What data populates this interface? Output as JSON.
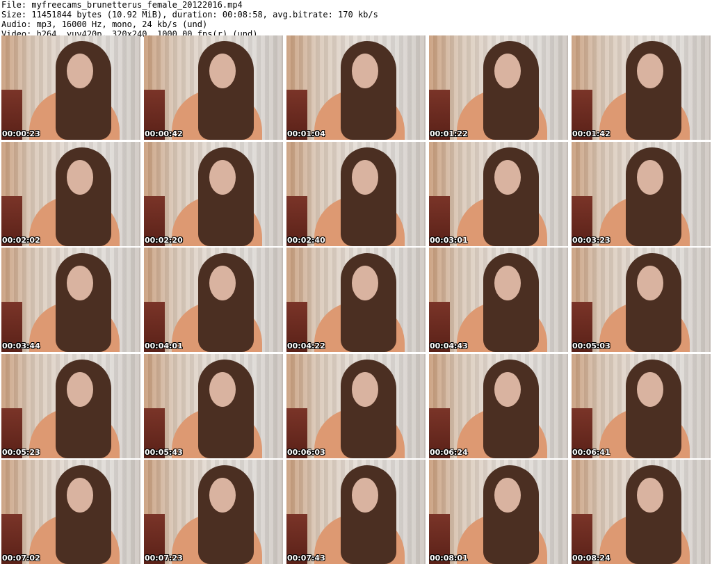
{
  "header": {
    "file_line": "File: myfreecams_brunetterus_female_20122016.mp4",
    "size_line": "Size: 11451844 bytes (10.92 MiB), duration: 00:08:58, avg.bitrate: 170 kb/s",
    "audio_line": "Audio: mp3, 16000 Hz, mono, 24 kb/s (und)",
    "video_line": "Video: h264, yuv420p, 320x240, 1000.00 fps(r) (und)"
  },
  "thumbnails": [
    {
      "timestamp": "00:00:23"
    },
    {
      "timestamp": "00:00:42"
    },
    {
      "timestamp": "00:01:04"
    },
    {
      "timestamp": "00:01:22"
    },
    {
      "timestamp": "00:01:42"
    },
    {
      "timestamp": "00:02:02"
    },
    {
      "timestamp": "00:02:20"
    },
    {
      "timestamp": "00:02:40"
    },
    {
      "timestamp": "00:03:01"
    },
    {
      "timestamp": "00:03:23"
    },
    {
      "timestamp": "00:03:44"
    },
    {
      "timestamp": "00:04:01"
    },
    {
      "timestamp": "00:04:22"
    },
    {
      "timestamp": "00:04:43"
    },
    {
      "timestamp": "00:05:03"
    },
    {
      "timestamp": "00:05:23"
    },
    {
      "timestamp": "00:05:43"
    },
    {
      "timestamp": "00:06:03"
    },
    {
      "timestamp": "00:06:24"
    },
    {
      "timestamp": "00:06:41"
    },
    {
      "timestamp": "00:07:02"
    },
    {
      "timestamp": "00:07:23"
    },
    {
      "timestamp": "00:07:43"
    },
    {
      "timestamp": "00:08:01"
    },
    {
      "timestamp": "00:08:24"
    }
  ]
}
